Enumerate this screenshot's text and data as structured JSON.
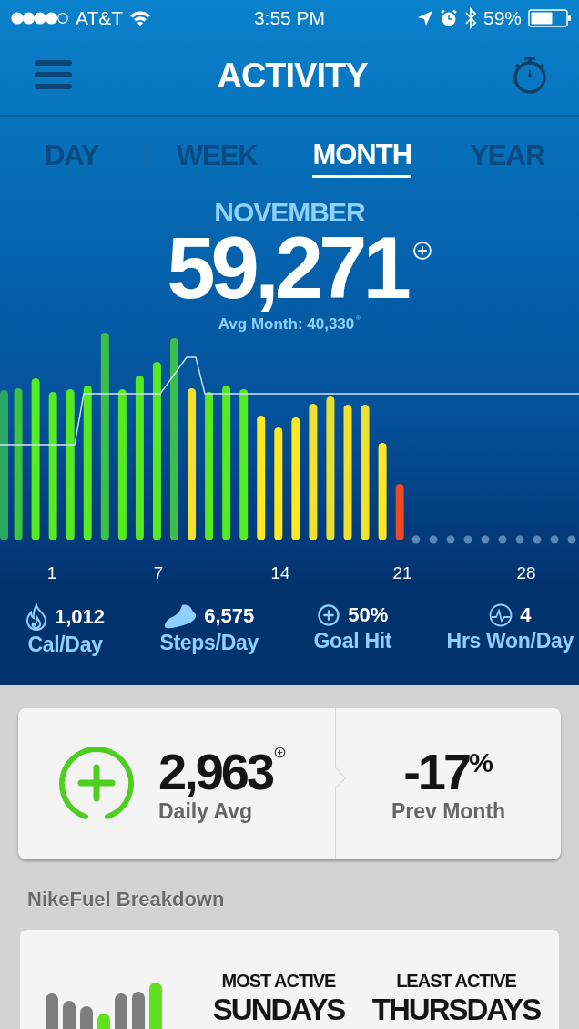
{
  "status_bar": {
    "carrier": "AT&T",
    "time": "3:55 PM",
    "battery": "59%"
  },
  "nav": {
    "title": "ACTIVITY"
  },
  "tabs": [
    {
      "label": "DAY",
      "selected": false
    },
    {
      "label": "WEEK",
      "selected": false
    },
    {
      "label": "MONTH",
      "selected": true
    },
    {
      "label": "YEAR",
      "selected": false
    }
  ],
  "summary": {
    "period": "NOVEMBER",
    "total": "59,271",
    "average": "Avg Month: 40,330"
  },
  "chart": {
    "x_labels": [
      "1",
      "7",
      "14",
      "21",
      "28"
    ]
  },
  "stats": [
    {
      "kind": "calories",
      "value": "1,012",
      "label": "Cal/Day"
    },
    {
      "kind": "steps",
      "value": "6,575",
      "label": "Steps/Day"
    },
    {
      "kind": "goal",
      "value": "50%",
      "label": "Goal Hit"
    },
    {
      "kind": "hours",
      "value": "4",
      "label": "Hrs Won/Day"
    }
  ],
  "daily_card": {
    "value": "2,963",
    "label": "Daily Avg",
    "change": "-17$^{%}$",
    "change_label": "Prev Month"
  },
  "breakdown": {
    "title": "NikeFuel Breakdown",
    "most": {
      "caption": "MOST ACTIVE",
      "day": "SUNDAYS"
    },
    "least": {
      "caption": "LEAST ACTIVE",
      "day": "THURSDAYS"
    }
  }
}
